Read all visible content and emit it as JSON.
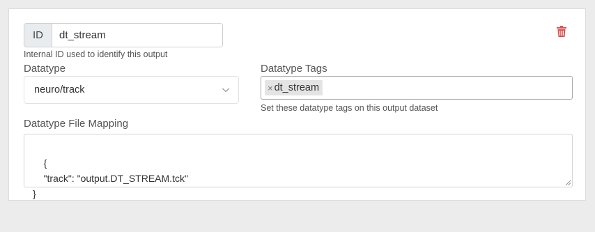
{
  "output": {
    "id_addon": "ID",
    "id_value": "dt_stream",
    "id_help": "Internal ID used to identify this output",
    "delete_icon": "trash-icon",
    "delete_color": "#d9534f"
  },
  "datatype": {
    "label": "Datatype",
    "selected": "neuro/track",
    "icon": "chevron-down-icon"
  },
  "datatype_tags": {
    "label": "Datatype Tags",
    "tags": [
      {
        "remove": "×",
        "label": "dt_stream"
      }
    ],
    "help": "Set these datatype tags on this output dataset"
  },
  "file_mapping": {
    "label": "Datatype File Mapping",
    "value": "{\n    \"track\": \"output.DT_STREAM.tck\"\n}"
  }
}
